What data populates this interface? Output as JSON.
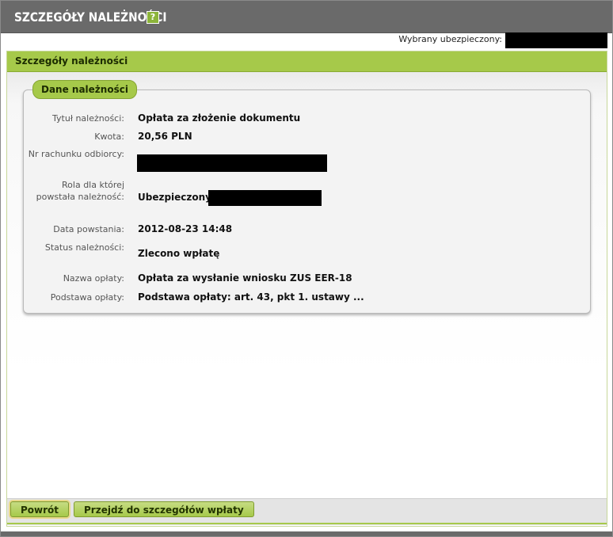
{
  "header": {
    "title": "SZCZEGÓŁY NALEŻNOŚCI",
    "help_symbol": "?"
  },
  "user": {
    "label": "Wybrany ubezpieczony:",
    "value_redacted": true
  },
  "panel": {
    "title": "Szczegóły należności",
    "group_title": "Dane należności",
    "fields": [
      {
        "label": "Tytuł należności:",
        "value": "Opłata za złożenie dokumentu"
      },
      {
        "label": "Kwota:",
        "value": "20,56 PLN"
      },
      {
        "label": "Nr rachunku odbiorcy:",
        "value": ""
      },
      {
        "label": "Rola dla której powstała należność:",
        "value": "Ubezpieczony"
      },
      {
        "label": "Data powstania:",
        "value": "2012-08-23 14:48"
      },
      {
        "label": "Status należności:",
        "value": "Zlecono wpłatę"
      },
      {
        "label": "Nazwa opłaty:",
        "value": "Opłata za wysłanie wniosku ZUS EER-18"
      },
      {
        "label": "Podstawa opłaty:",
        "value": "Podstawa opłaty: art. 43, pkt 1. ustawy ..."
      }
    ]
  },
  "buttons": {
    "back": "Powrót",
    "go_payment": "Przejdź do szczegółów wpłaty"
  },
  "colors": {
    "accent": "#a6c94a",
    "header_bg": "#6a6a6a"
  }
}
